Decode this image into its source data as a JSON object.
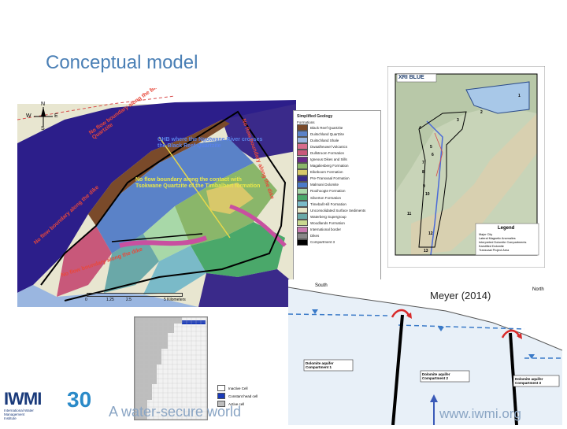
{
  "slide": {
    "title": "Conceptual model",
    "citation": "Meyer (2014)",
    "tagline": "A water-secure world",
    "url": "www.iwmi.org"
  },
  "geology_map": {
    "north_label": "N",
    "west_label": "W",
    "east_label": "E",
    "south_label": "S",
    "annotation_ghb": "GHB where the Ngotwane River crosses the Black Reef Quartzite",
    "annotation_nf_contact": "No flow boundary along the contact with Tsokwane Quartzite of the Timbalbert formation",
    "annotation_nf_top": "No flow boundary along the Black Reef Quartzite",
    "annotation_nf_right": "No flow boundary along the dike",
    "annotation_nf_left": "No flow boundary along the dike",
    "annotation_nf_bottom": "No flow boundary along the dike",
    "scale_ticks": [
      "0",
      "1.25",
      "2.5",
      "5 Kilometers"
    ]
  },
  "legend": {
    "title": "Simplified Geology",
    "subtitle": "Formations",
    "items": [
      {
        "label": "Black Reef Quartzite",
        "color": "#7a4a2a"
      },
      {
        "label": "Duitschland Quartzite",
        "color": "#5a82c8"
      },
      {
        "label": "Duitschland Shale",
        "color": "#9ab6e0"
      },
      {
        "label": "Dwaalheuwel Volcanics",
        "color": "#d86d8c"
      },
      {
        "label": "Dullstroom Formation",
        "color": "#c8587a"
      },
      {
        "label": "Igneous Dikes and Sills",
        "color": "#6a2a8a"
      },
      {
        "label": "Magaliesberg Formation",
        "color": "#8ab66a"
      },
      {
        "label": "Eikeboom Formation",
        "color": "#d8c86a"
      },
      {
        "label": "Pre-Transvaal Formation",
        "color": "#3a2a8a"
      },
      {
        "label": "Malmani Dolomite",
        "color": "#4a7ac8"
      },
      {
        "label": "Rooihoogte Formation",
        "color": "#a8d8a8"
      },
      {
        "label": "Silverton Formation",
        "color": "#4aa86a"
      },
      {
        "label": "Timeball Hill Formation",
        "color": "#7abac8"
      },
      {
        "label": "Unconsolidated Surface Sediments",
        "color": "#e8e8c8"
      },
      {
        "label": "Waterberg Supergroup",
        "color": "#6aa8a8"
      },
      {
        "label": "Woodlands Formation",
        "color": "#c8d890"
      },
      {
        "label": "International border",
        "color": "#c87ab0"
      },
      {
        "label": "Dikes",
        "color": "#888888"
      },
      {
        "label": "Compartment 3",
        "color": "#000000"
      }
    ]
  },
  "site_map": {
    "logo_text": "XRI BLUE",
    "legend_title": "Legend",
    "legend_items": [
      "Major City",
      "Lateral Magnetic Anomalies",
      "Interpreted Dolomite Compartments",
      "Karstified Dolomite",
      "Transvaal Project Area"
    ],
    "compartment_numbers": [
      "1",
      "2",
      "3",
      "4",
      "5",
      "6",
      "7",
      "8",
      "9",
      "10",
      "11",
      "12",
      "13"
    ]
  },
  "cross_section": {
    "south_label": "South",
    "north_label": "North",
    "compartment1": "Dolomite aquifer Compartment 1",
    "compartment2": "Dolomite aquifer Compartment 2",
    "compartment3": "Dolomite aquifer Compartment 3"
  },
  "model_grid": {
    "legend_items": [
      "Inactive Cell",
      "Constant head cell",
      "Active cell"
    ]
  },
  "logo": {
    "name": "IWMI",
    "anniversary": "30",
    "subtitle": "International Water Management Institute"
  }
}
